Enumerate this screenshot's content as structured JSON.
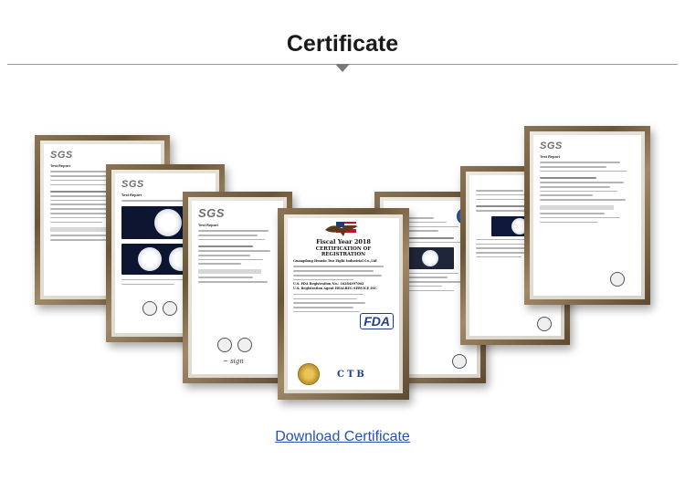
{
  "page": {
    "title": "Certificate",
    "download_label": "Download Certificate"
  },
  "certificates": {
    "sgs_logo": "SGS",
    "test_report": "Test Report",
    "fiscal_year": "Fiscal Year 2018",
    "registration_title": "CERTIFICATION OF REGISTRATION",
    "company_line": "Guangdong Huaxin Two Eight Industrial Co.,Ltd",
    "fda_reg": "U.S. FDA Registration No.: 16284397002",
    "agent": "U.S. Registration Agent HEALREG SERVICE INC",
    "fda_mark": "FDA",
    "ctb_mark": "CTB"
  },
  "colors": {
    "frame": "#6b5538",
    "link": "#2550b4",
    "rule": "#9a9a9a"
  }
}
